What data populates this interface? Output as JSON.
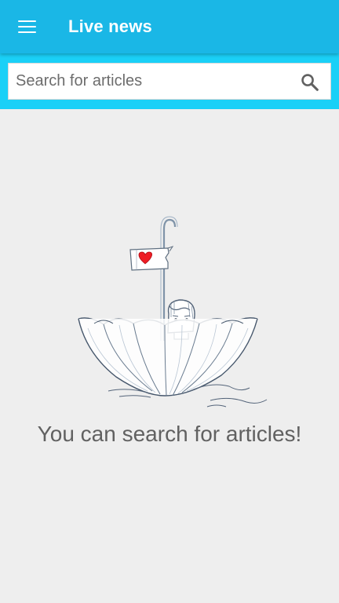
{
  "appbar": {
    "title": "Live news",
    "menu_icon": "hamburger-menu-icon",
    "color": "#1ab7e6"
  },
  "search": {
    "placeholder": "Search for articles",
    "value": "",
    "icon": "search-icon",
    "band_color": "#1ad0f7"
  },
  "empty_state": {
    "message": "You can search for articles!",
    "illustration": "girl-in-umbrella-boat-with-heart-flag"
  }
}
